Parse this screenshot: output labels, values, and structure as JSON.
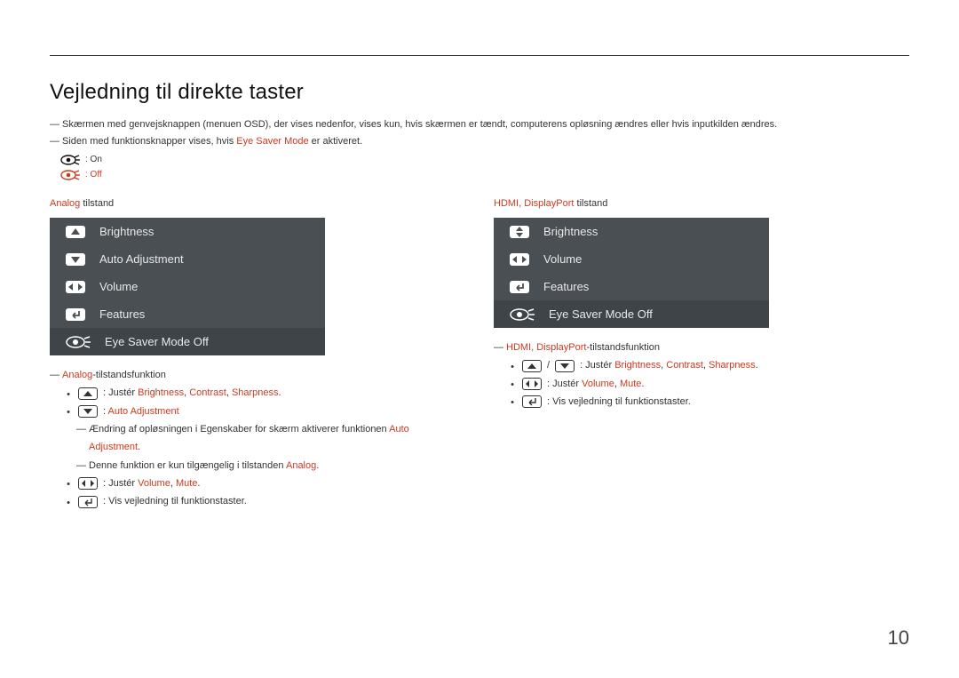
{
  "heading": "Vejledning til direkte taster",
  "intro": {
    "line1": "Skærmen med genvejsknappen (menuen OSD), der vises nedenfor, vises kun, hvis skærmen er tændt, computerens opløsning ændres eller hvis inputkilden ændres.",
    "line2_pre": "Siden med funktionsknapper vises, hvis ",
    "line2_hi": "Eye Saver Mode",
    "line2_post": " er aktiveret."
  },
  "legend": {
    "on": ": On",
    "off": ": Off"
  },
  "analog": {
    "mode_hi": "Analog",
    "mode_plain": " tilstand",
    "osd": {
      "brightness": "Brightness",
      "auto": "Auto Adjustment",
      "volume": "Volume",
      "features": "Features",
      "eyesaver": "Eye Saver Mode Off"
    },
    "notes": {
      "title_hi": "Analog",
      "title_post": "-tilstandsfunktion",
      "juster": ": Justér ",
      "b": "Brightness",
      "c": "Contrast",
      "s": "Sharpness",
      "period": ".",
      "comma": ", ",
      "auto_hi": "Auto Adjustment",
      "auto_pre": ": ",
      "n1_pre": "Ændring af opløsningen i Egenskaber for skærm aktiverer funktionen ",
      "n1_hi": "Auto Adjustment",
      "n1_post": ".",
      "n2_pre": "Denne funktion er kun tilgængelig i tilstanden ",
      "n2_hi": "Analog",
      "n2_post": ".",
      "volmute_pre": ": Justér ",
      "vol": "Volume",
      "mute": "Mute",
      "vis": ": Vis vejledning til funktionstaster."
    }
  },
  "hdmi": {
    "mode_hi": "HDMI, DisplayPort",
    "mode_plain": " tilstand",
    "osd": {
      "brightness": "Brightness",
      "volume": "Volume",
      "features": "Features",
      "eyesaver": "Eye Saver Mode Off"
    },
    "notes": {
      "title_hi": "HDMI, DisplayPort",
      "title_post": "-tilstandsfunktion",
      "slash": "/",
      "juster": ": Justér ",
      "b": "Brightness",
      "c": "Contrast",
      "s": "Sharpness",
      "period": ".",
      "comma": ", ",
      "volmute_pre": ": Justér ",
      "vol": "Volume",
      "mute": "Mute",
      "vis": ": Vis vejledning til funktionstaster."
    }
  },
  "page": "10"
}
